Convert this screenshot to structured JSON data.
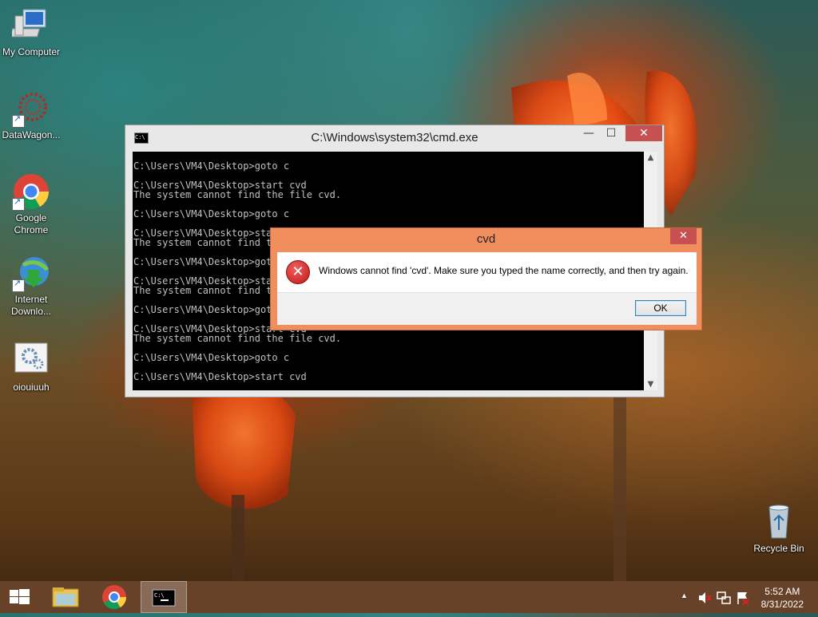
{
  "desktop": {
    "icons": [
      {
        "label": "My Computer",
        "icon": "computer-icon"
      },
      {
        "label": "DataWagon...",
        "icon": "datawagon-icon"
      },
      {
        "label": "Google Chrome",
        "icon": "chrome-icon"
      },
      {
        "label": "Internet Downlo...",
        "icon": "internet-download-manager-icon"
      },
      {
        "label": "oiouiuuh",
        "icon": "settings-file-icon"
      },
      {
        "label": "Recycle Bin",
        "icon": "recycle-bin-icon"
      }
    ]
  },
  "cmd_window": {
    "title": "C:\\Windows\\system32\\cmd.exe",
    "minimize_glyph": "—",
    "maximize_glyph": "☐",
    "close_glyph": "✕",
    "lines": [
      "C:\\Users\\VM4\\Desktop>goto c",
      "",
      "C:\\Users\\VM4\\Desktop>start cvd",
      "The system cannot find the file cvd.",
      "",
      "C:\\Users\\VM4\\Desktop>goto c",
      "",
      "C:\\Users\\VM4\\Desktop>start cvd",
      "The system cannot find the file cvd.",
      "",
      "C:\\Users\\VM4\\Desktop>goto c",
      "",
      "C:\\Users\\VM4\\Desktop>start cvd",
      "The system cannot find the file cvd.",
      "",
      "C:\\Users\\VM4\\Desktop>goto c",
      "",
      "C:\\Users\\VM4\\Desktop>start cvd",
      "The system cannot find the file cvd.",
      "",
      "C:\\Users\\VM4\\Desktop>goto c",
      "",
      "C:\\Users\\VM4\\Desktop>start cvd"
    ]
  },
  "dialog": {
    "title": "cvd",
    "close_glyph": "✕",
    "message": "Windows cannot find 'cvd'. Make sure you typed the name correctly, and then try again.",
    "ok_label": "OK",
    "icon": "error-icon"
  },
  "taskbar": {
    "items": [
      "start-button",
      "file-explorer-icon",
      "chrome-icon",
      "cmd-icon"
    ],
    "time": "5:52 AM",
    "date": "8/31/2022",
    "tray_icons": [
      "show-hidden-icons",
      "volume-muted-icon",
      "network-icon",
      "action-center-flag-icon"
    ],
    "tray_chevron": "▲"
  },
  "colors": {
    "dialog_frame": "#f08e5e",
    "close_button": "#c75050",
    "console_bg": "#000000",
    "console_text": "#c0c0c0"
  }
}
